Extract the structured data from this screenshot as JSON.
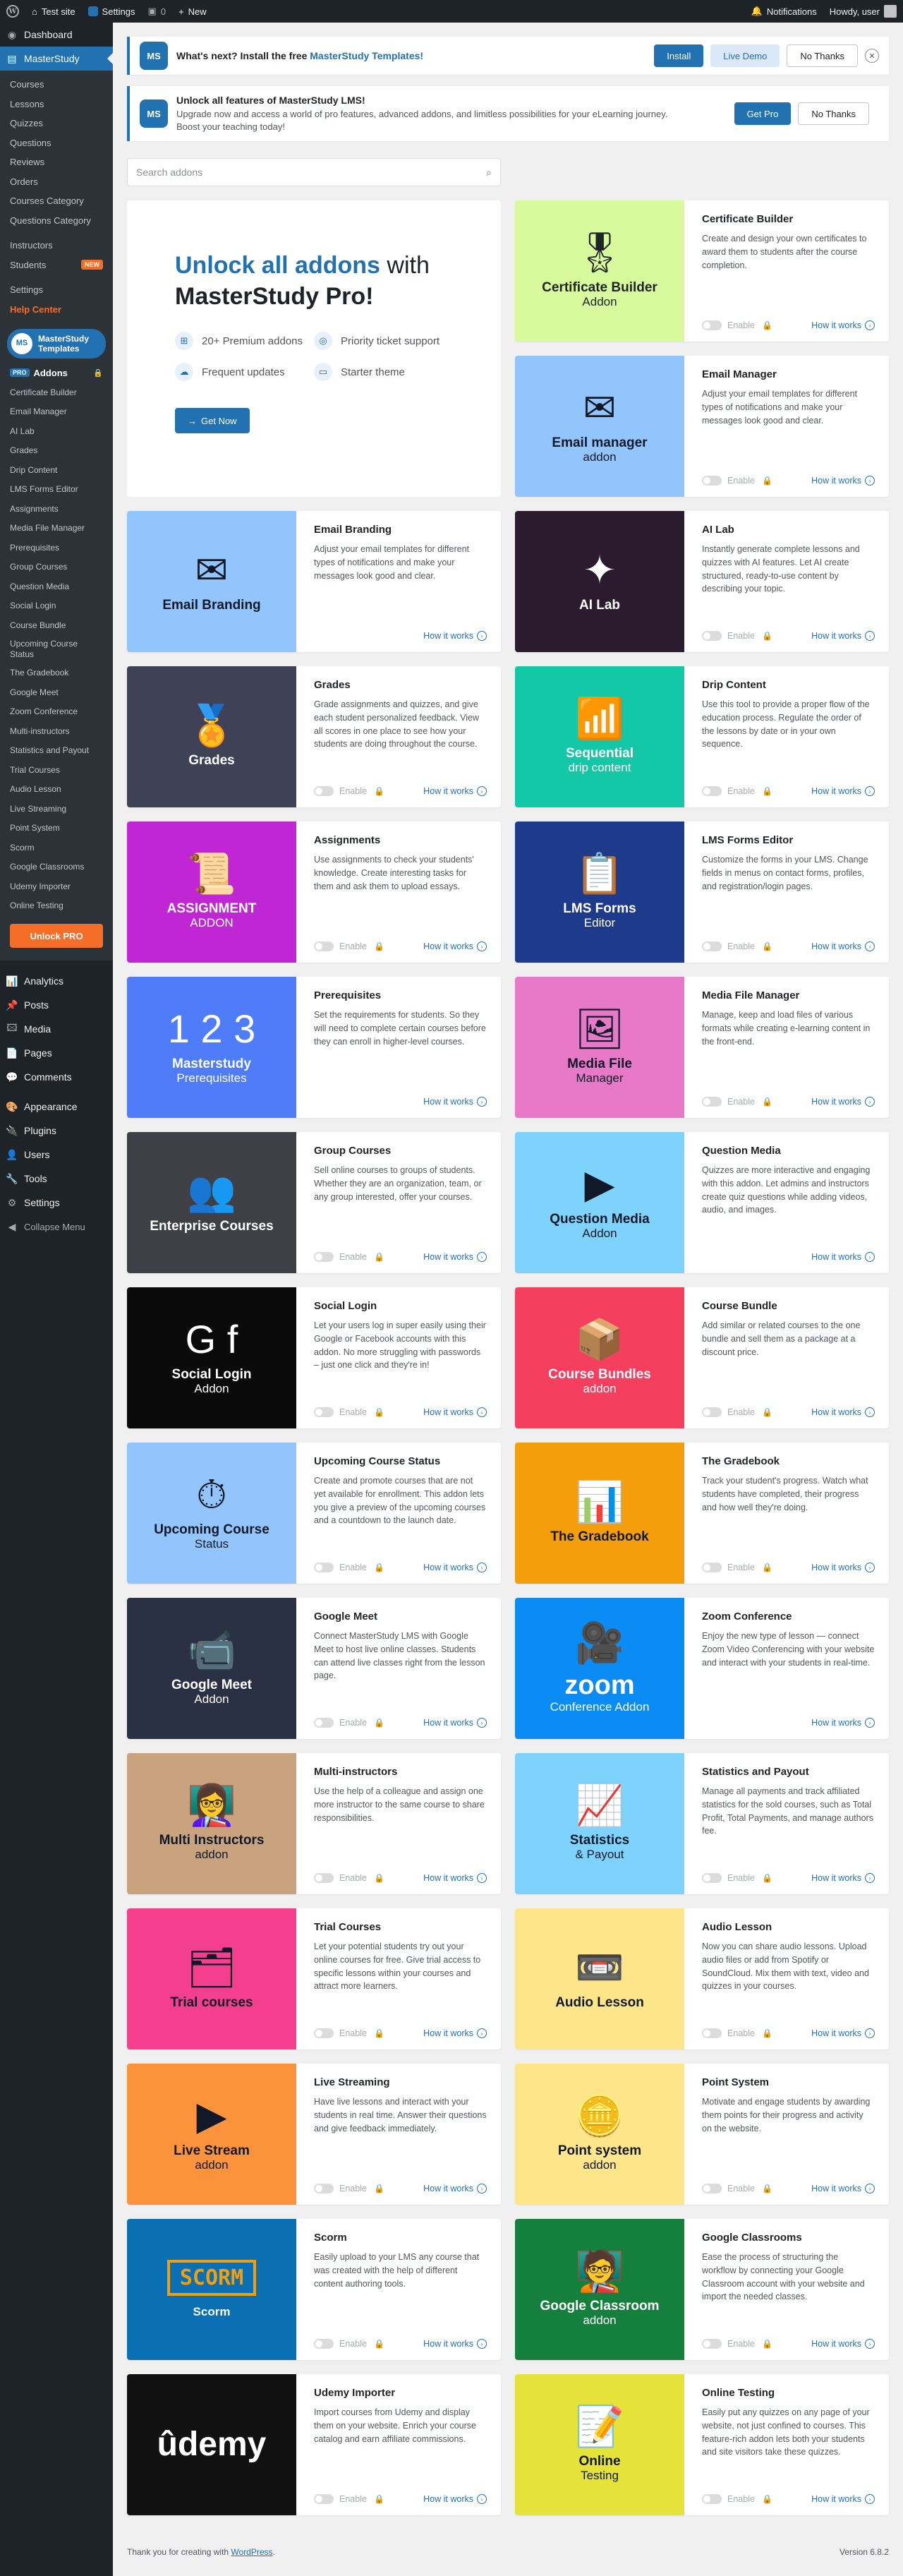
{
  "adminbar": {
    "site": "Test site",
    "settings": "Settings",
    "comments_count": "0",
    "new": "New",
    "notifications": "Notifications",
    "howdy": "Howdy, user"
  },
  "sidebar": {
    "dashboard": "Dashboard",
    "masterstudy": "MasterStudy",
    "sub": [
      "Courses",
      "Lessons",
      "Quizzes",
      "Questions",
      "Reviews",
      "Orders",
      "Courses Category",
      "Questions Category"
    ],
    "sub2": [
      "Instructors",
      "Students"
    ],
    "new_badge": "NEW",
    "sub3": [
      "Settings"
    ],
    "help": "Help Center",
    "templates": "MasterStudy Templates",
    "pro_badge": "PRO",
    "addons": "Addons",
    "addon_items": [
      "Certificate Builder",
      "Email Manager",
      "AI Lab",
      "Grades",
      "Drip Content",
      "LMS Forms Editor",
      "Assignments",
      "Media File Manager",
      "Prerequisites",
      "Group Courses",
      "Question Media",
      "Social Login",
      "Course Bundle",
      "Upcoming Course Status",
      "The Gradebook",
      "Google Meet",
      "Zoom Conference",
      "Multi-instructors",
      "Statistics and Payout",
      "Trial Courses",
      "Audio Lesson",
      "Live Streaming",
      "Point System",
      "Scorm",
      "Google Classrooms",
      "Udemy Importer",
      "Online Testing"
    ],
    "unlock": "Unlock PRO",
    "main": [
      "Analytics",
      "Posts",
      "Media",
      "Pages",
      "Comments",
      "Appearance",
      "Plugins",
      "Users",
      "Tools",
      "Settings"
    ],
    "collapse": "Collapse Menu"
  },
  "notice1": {
    "text": "What's next? Install the free ",
    "link": "MasterStudy Templates!",
    "install": "Install",
    "demo": "Live Demo",
    "nothanks": "No Thanks"
  },
  "notice2": {
    "title": "Unlock all features of MasterStudy LMS!",
    "text": "Upgrade now and access a world of pro features, advanced addons, and limitless possibilities for your eLearning journey. Boost your teaching today!",
    "getpro": "Get Pro",
    "nothanks": "No Thanks"
  },
  "search": {
    "placeholder": "Search addons"
  },
  "promo": {
    "hl": "Unlock all addons",
    "with": " with",
    "line2": "MasterStudy Pro!",
    "feats": [
      "20+ Premium addons",
      "Priority ticket support",
      "Frequent updates",
      "Starter theme"
    ],
    "cta": "Get Now"
  },
  "labels": {
    "enable": "Enable",
    "how": "How it works"
  },
  "colors": {
    "brand": "#2271b1",
    "accent": "#f56e28",
    "sidebar": "#1d2327"
  },
  "addons": [
    {
      "title": "Certificate Builder",
      "desc": "Create and design your own certificates to award them to students after the course completion.",
      "img1": "Certificate Builder",
      "img2": "Addon",
      "bg": "#d9f99d",
      "fg": "#1d2327",
      "icon": "🎖",
      "col": 1,
      "row": 0,
      "toggle": true
    },
    {
      "title": "Email Manager",
      "desc": "Adjust your email templates for different types of notifications and make your messages look good and clear.",
      "img1": "Email manager",
      "img2": "addon",
      "bg": "#93c5fd",
      "fg": "#111827",
      "icon": "✉",
      "col": 1,
      "row": 1,
      "toggle": true
    },
    {
      "title": "Email Branding",
      "desc": "Adjust your email templates for different types of notifications and make your messages look good and clear.",
      "img1": "Email Branding",
      "img2": "",
      "bg": "#93c5fd",
      "fg": "#111827",
      "icon": "✉",
      "col": 0,
      "row": 2,
      "toggle": false
    },
    {
      "title": "AI Lab",
      "desc": "Instantly generate complete lessons and quizzes with AI features. Let AI create structured, ready-to-use content by describing your topic.",
      "img1": "AI Lab",
      "img2": "",
      "bg": "#2a1b2e",
      "fg": "#ffffff",
      "icon": "✦",
      "col": 1,
      "row": 2,
      "toggle": true
    },
    {
      "title": "Grades",
      "desc": "Grade assignments and quizzes, and give each student personalized feedback. View all scores in one place to see how your students are doing throughout the course.",
      "img1": "Grades",
      "img2": "",
      "bg": "#3f4257",
      "fg": "#ffffff",
      "icon": "🏅",
      "col": 0,
      "row": 3,
      "toggle": true
    },
    {
      "title": "Drip Content",
      "desc": "Use this tool to provide a proper flow of the education process. Regulate the order of the lessons by date or in your own sequence.",
      "img1": "Sequential",
      "img2": "drip content",
      "bg": "#14c7a6",
      "fg": "#ffffff",
      "icon": "📶",
      "col": 1,
      "row": 3,
      "toggle": true
    },
    {
      "title": "Assignments",
      "desc": "Use assignments to check your students' knowledge. Create interesting tasks for them and ask them to upload essays.",
      "img1": "ASSIGNMENT",
      "img2": "ADDON",
      "bg": "#c026d3",
      "fg": "#ffffff",
      "icon": "📜",
      "col": 0,
      "row": 4,
      "toggle": true
    },
    {
      "title": "LMS Forms Editor",
      "desc": "Customize the forms in your LMS. Change fields in menus on contact forms, profiles, and registration/login pages.",
      "img1": "LMS Forms",
      "img2": "Editor",
      "bg": "#1e3a8a",
      "fg": "#ffffff",
      "icon": "📋",
      "col": 1,
      "row": 4,
      "toggle": true
    },
    {
      "title": "Prerequisites",
      "desc": "Set the requirements for students. So they will need to complete certain courses before they can enroll in higher-level courses.",
      "img1": "Masterstudy",
      "img2": "Prerequisites",
      "bg": "#4f7df9",
      "fg": "#ffffff",
      "icon": "1 2 3",
      "col": 0,
      "row": 5,
      "toggle": false
    },
    {
      "title": "Media File Manager",
      "desc": "Manage, keep and load files of various formats while creating e-learning content in the front-end.",
      "img1": "Media File",
      "img2": "Manager",
      "bg": "#e879c9",
      "fg": "#111827",
      "icon": "🖼",
      "col": 1,
      "row": 5,
      "toggle": true
    },
    {
      "title": "Group Courses",
      "desc": "Sell online courses to groups of students. Whether they are an organization, team, or any group interested, offer your courses.",
      "img1": "Enterprise Courses",
      "img2": "",
      "bg": "#3f3f46",
      "fg": "#ffffff",
      "icon": "👥",
      "col": 0,
      "row": 6,
      "toggle": true
    },
    {
      "title": "Question Media",
      "desc": "Quizzes are more interactive and engaging with this addon. Let admins and instructors create quiz questions while adding videos, audio, and images.",
      "img1": "Question Media",
      "img2": "Addon",
      "bg": "#7dd3fc",
      "fg": "#111827",
      "icon": "▶",
      "col": 1,
      "row": 6,
      "toggle": false
    },
    {
      "title": "Social Login",
      "desc": "Let your users log in super easily using their Google or Facebook accounts with this addon. No more struggling with passwords – just one click and they're in!",
      "img1": "Social Login",
      "img2": "Addon",
      "bg": "#0a0a0a",
      "fg": "#ffffff",
      "icon": "G f",
      "col": 0,
      "row": 7,
      "toggle": true
    },
    {
      "title": "Course Bundle",
      "desc": "Add similar or related courses to the one bundle and sell them as a package at a discount price.",
      "img1": "Course Bundles",
      "img2": "addon",
      "bg": "#f43f5e",
      "fg": "#ffffff",
      "icon": "📦",
      "col": 1,
      "row": 7,
      "toggle": true
    },
    {
      "title": "Upcoming Course Status",
      "desc": "Create and promote courses that are not yet available for enrollment. This addon lets you give a preview of the upcoming courses and a countdown to the launch date.",
      "img1": "Upcoming Course",
      "img2": "Status",
      "bg": "#93c5fd",
      "fg": "#111827",
      "icon": "⏱",
      "col": 0,
      "row": 8,
      "toggle": true
    },
    {
      "title": "The Gradebook",
      "desc": "Track your student's progress. Watch what students have completed, their progress and how well they're doing.",
      "img1": "The Gradebook",
      "img2": "",
      "bg": "#f59e0b",
      "fg": "#111827",
      "icon": "📊",
      "col": 1,
      "row": 8,
      "toggle": true
    },
    {
      "title": "Google Meet",
      "desc": "Connect MasterStudy LMS with Google Meet to host live online classes. Students can attend live classes right from the lesson page.",
      "img1": "Google Meet",
      "img2": "Addon",
      "bg": "#2b3144",
      "fg": "#ffffff",
      "icon": "📹",
      "col": 0,
      "row": 9,
      "toggle": true
    },
    {
      "title": "Zoom Conference",
      "desc": "Enjoy the new type of lesson — connect Zoom Video Conferencing with your website and interact with your students in real-time.",
      "img1": "zoom",
      "img2": "Conference Addon",
      "bg": "#0b8cf5",
      "fg": "#ffffff",
      "icon": "🎥",
      "col": 1,
      "row": 9,
      "toggle": false
    },
    {
      "title": "Multi-instructors",
      "desc": "Use the help of a colleague and assign one more instructor to the same course to share responsibilities.",
      "img1": "Multi Instructors",
      "img2": "addon",
      "bg": "#c9a27e",
      "fg": "#111827",
      "icon": "👩‍🏫",
      "col": 0,
      "row": 10,
      "toggle": true
    },
    {
      "title": "Statistics and Payout",
      "desc": "Manage all payments and track affiliated statistics for the sold courses, such as Total Profit, Total Payments, and manage authors fee.",
      "img1": "Statistics",
      "img2": "& Payout",
      "bg": "#7dd3fc",
      "fg": "#111827",
      "icon": "📈",
      "col": 1,
      "row": 10,
      "toggle": true
    },
    {
      "title": "Trial Courses",
      "desc": "Let your potential students try out your online courses for free. Give trial access to specific lessons within your courses and attract more learners.",
      "img1": "Trial courses",
      "img2": "",
      "bg": "#f43f8e",
      "fg": "#111827",
      "icon": "🗂",
      "col": 0,
      "row": 11,
      "toggle": true
    },
    {
      "title": "Audio Lesson",
      "desc": "Now you can share audio lessons. Upload audio files or add from Spotify or SoundCloud. Mix them with text, video and quizzes in your courses.",
      "img1": "Audio Lesson",
      "img2": "",
      "bg": "#fde68a",
      "fg": "#111827",
      "icon": "📼",
      "col": 1,
      "row": 11,
      "toggle": true
    },
    {
      "title": "Live Streaming",
      "desc": "Have live lessons and interact with your students in real time. Answer their questions and give feedback immediately.",
      "img1": "Live Stream",
      "img2": "addon",
      "bg": "#fb923c",
      "fg": "#111827",
      "icon": "▶",
      "col": 0,
      "row": 12,
      "toggle": true
    },
    {
      "title": "Point System",
      "desc": "Motivate and engage students by awarding them points for their progress and activity on the website.",
      "img1": "Point system",
      "img2": "addon",
      "bg": "#fde68a",
      "fg": "#111827",
      "icon": "🪙",
      "col": 1,
      "row": 12,
      "toggle": true
    },
    {
      "title": "Scorm",
      "desc": "Easily upload to your LMS any course that was created with the help of different content authoring tools.",
      "img1": "SCORM",
      "img2": "Scorm",
      "bg": "#0b6fb4",
      "fg": "#ffffff",
      "icon": "",
      "col": 0,
      "row": 13,
      "toggle": true
    },
    {
      "title": "Google Classrooms",
      "desc": "Ease the process of structuring the workflow by connecting your Google Classroom account with your website and import the needed classes.",
      "img1": "Google Classroom",
      "img2": "addon",
      "bg": "#15803d",
      "fg": "#ffffff",
      "icon": "🧑‍🏫",
      "col": 1,
      "row": 13,
      "toggle": true
    },
    {
      "title": "Udemy Importer",
      "desc": "Import courses from Udemy and display them on your website. Enrich your course catalog and earn affiliate commissions.",
      "img1": "ûdemy",
      "img2": "",
      "bg": "#111111",
      "fg": "#ffffff",
      "icon": "",
      "col": 0,
      "row": 14,
      "toggle": true
    },
    {
      "title": "Online Testing",
      "desc": "Easily put any quizzes on any page of your website, not just confined to courses. This feature-rich addon lets both your students and site visitors take these quizzes.",
      "img1": "Online",
      "img2": "Testing",
      "bg": "#e5e23a",
      "fg": "#111827",
      "icon": "📝",
      "col": 1,
      "row": 14,
      "toggle": true
    }
  ],
  "footer": {
    "text": "Thank you for creating with ",
    "link": "WordPress",
    "suffix": ".",
    "version": "Version 6.8.2"
  }
}
